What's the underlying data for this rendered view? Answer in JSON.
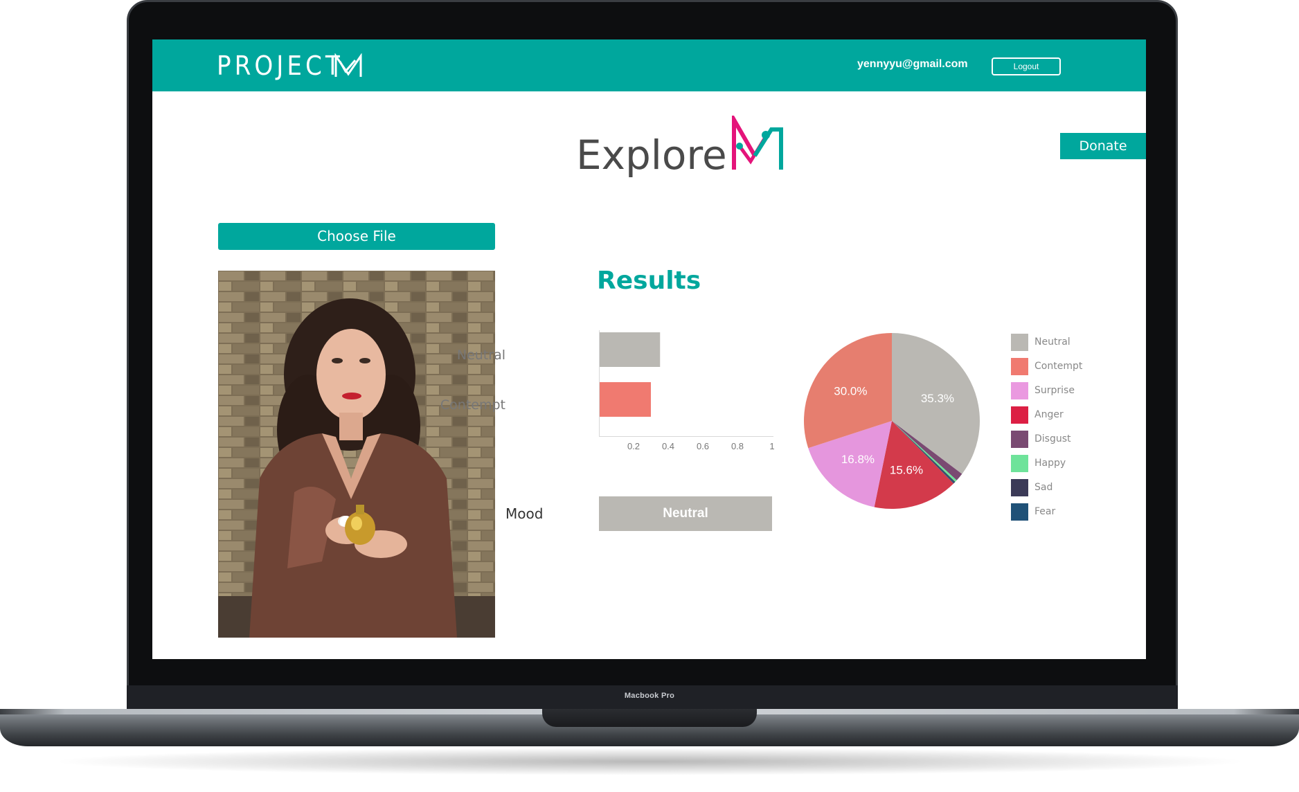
{
  "device": {
    "label": "Macbook Pro"
  },
  "header": {
    "brand": "PROJECT",
    "user_email": "yennyyu@gmail.com",
    "logout_label": "Logout"
  },
  "page": {
    "title": "Explore",
    "donate_label": "Donate",
    "choose_file_label": "Choose File",
    "results_title": "Results",
    "mood_label": "Mood",
    "mood_value": "Neutral"
  },
  "colors": {
    "accent": "#00a79d",
    "logo_pink": "#e4147a",
    "logo_teal": "#00a79d"
  },
  "chart_data": [
    {
      "type": "bar",
      "orientation": "horizontal",
      "categories": [
        "Neutral",
        "Contempt"
      ],
      "values": [
        0.353,
        0.3
      ],
      "colors": [
        "#bab8b3",
        "#f07a70"
      ],
      "xticks": [
        "0.2",
        "0.4",
        "0.6",
        "0.8",
        "1"
      ],
      "xlim": [
        0,
        1
      ]
    },
    {
      "type": "pie",
      "slices": [
        {
          "label": "Neutral",
          "value": 35.3,
          "text": "35.3%",
          "color": "#bab8b3"
        },
        {
          "label": "Disgust",
          "value": 1.5,
          "text": "",
          "color": "#7a4a72"
        },
        {
          "label": "Happy",
          "value": 0.4,
          "text": "",
          "color": "#6ee39a"
        },
        {
          "label": "Sad",
          "value": 0.2,
          "text": "",
          "color": "#3b3a57"
        },
        {
          "label": "Fear",
          "value": 0.2,
          "text": "",
          "color": "#1f5177"
        },
        {
          "label": "Anger",
          "value": 15.6,
          "text": "15.6%",
          "color": "#d33a4b"
        },
        {
          "label": "Surprise",
          "value": 16.8,
          "text": "16.8%",
          "color": "#e596dd"
        },
        {
          "label": "Contempt",
          "value": 30.0,
          "text": "30.0%",
          "color": "#e67e6f"
        }
      ],
      "legend": [
        {
          "label": "Neutral",
          "color": "#bab8b3"
        },
        {
          "label": "Contempt",
          "color": "#f07a70"
        },
        {
          "label": "Surprise",
          "color": "#ea99e0"
        },
        {
          "label": "Anger",
          "color": "#dc1f44"
        },
        {
          "label": "Disgust",
          "color": "#7a4a72"
        },
        {
          "label": "Happy",
          "color": "#6ee39a"
        },
        {
          "label": "Sad",
          "color": "#3b3a57"
        },
        {
          "label": "Fear",
          "color": "#1f5177"
        }
      ],
      "legend_position": "right"
    }
  ]
}
